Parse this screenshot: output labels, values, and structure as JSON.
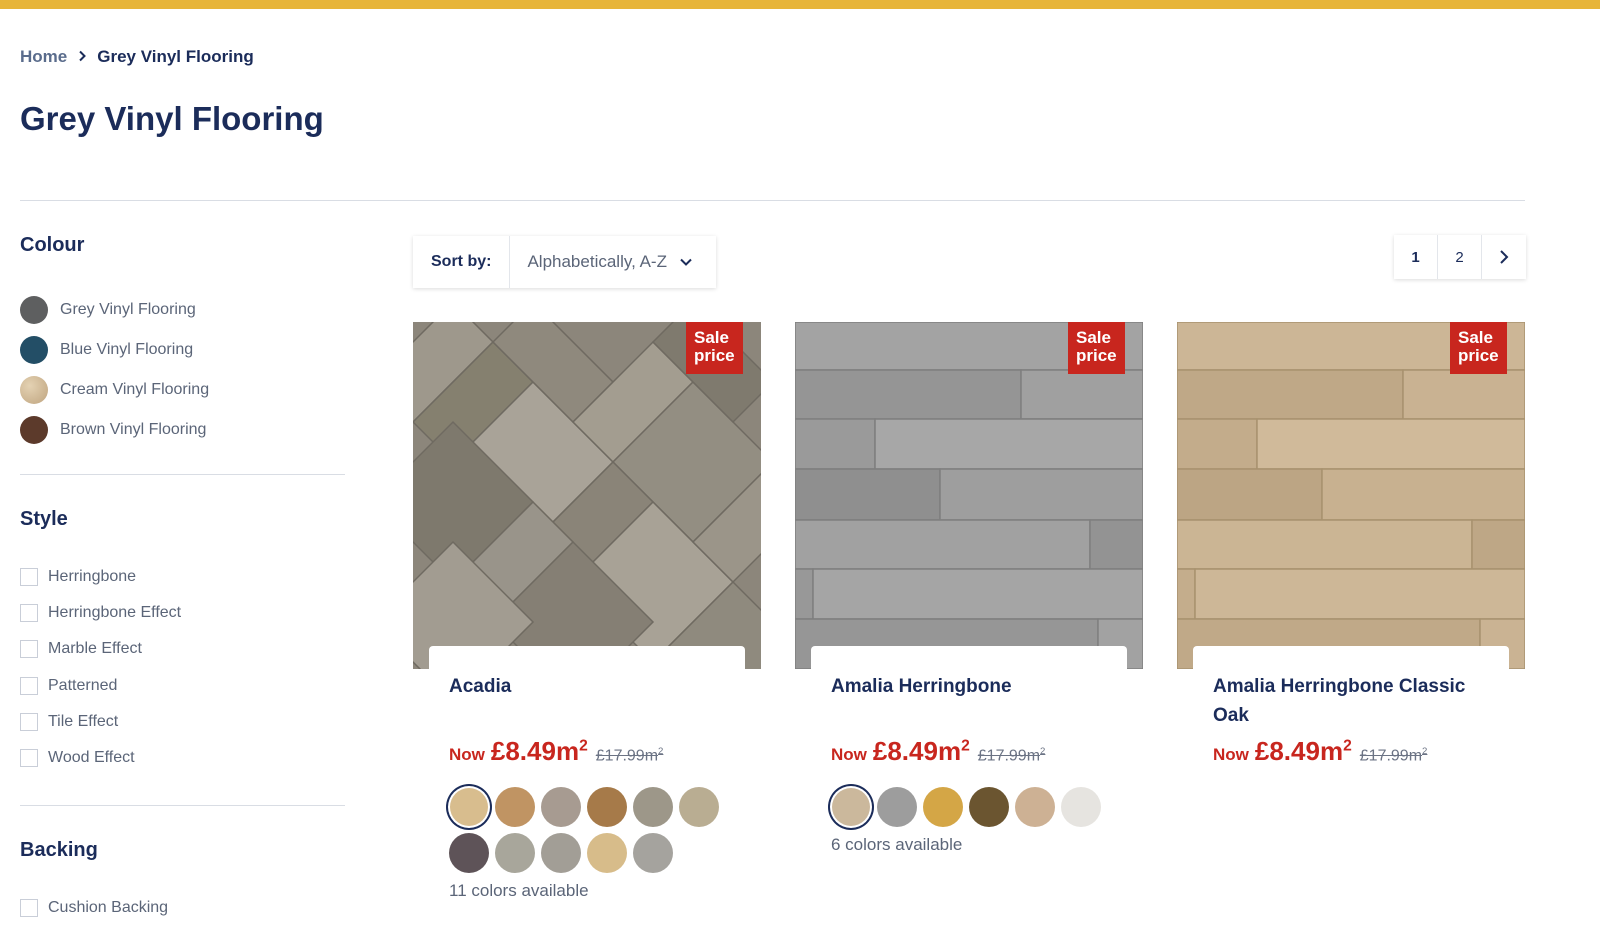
{
  "breadcrumb": {
    "home": "Home",
    "separator": "›",
    "current": "Grey Vinyl Flooring"
  },
  "page_title": "Grey Vinyl Flooring",
  "colors": {
    "accent_bar": "#e7b53a",
    "navy": "#1b2c5a",
    "sale_red": "#c8261e"
  },
  "sidebar": {
    "colour": {
      "heading": "Colour",
      "items": [
        {
          "label": "Grey Vinyl Flooring",
          "swatch": "#5e5f60"
        },
        {
          "label": "Blue Vinyl Flooring",
          "swatch": "#234e66"
        },
        {
          "label": "Cream Vinyl Flooring",
          "swatch": "#cdb593"
        },
        {
          "label": "Brown Vinyl Flooring",
          "swatch": "#5c3a2b"
        }
      ]
    },
    "style": {
      "heading": "Style",
      "items": [
        "Herringbone",
        "Herringbone Effect",
        "Marble Effect",
        "Patterned",
        "Tile Effect",
        "Wood Effect"
      ]
    },
    "backing": {
      "heading": "Backing",
      "items": [
        "Cushion Backing"
      ]
    }
  },
  "toolbar": {
    "sort_label": "Sort by:",
    "sort_value": "Alphabetically, A-Z",
    "pages": [
      "1",
      "2"
    ],
    "active_page": "1"
  },
  "products": [
    {
      "name": "Acadia",
      "badge": "Sale price",
      "now_label": "Now",
      "price": "£8.49m",
      "price_unit_sup": "2",
      "was_price": "£17.99m",
      "was_unit_sup": "2",
      "swatches": [
        "#d8bd8e",
        "#c09463",
        "#a79b91",
        "#a67a49",
        "#9d9789",
        "#b9ad92",
        "#5e5358",
        "#a8a69b",
        "#a29e96",
        "#d7bc8a",
        "#a5a39e"
      ],
      "colors_available": "11 colors available"
    },
    {
      "name": "Amalia Herringbone",
      "badge": "Sale price",
      "now_label": "Now",
      "price": "£8.49m",
      "price_unit_sup": "2",
      "was_price": "£17.99m",
      "was_unit_sup": "2",
      "swatches": [
        "#cbb89c",
        "#9d9d9d",
        "#d4a646",
        "#6b5530",
        "#cdb194",
        "#e6e4e0"
      ],
      "colors_available": "6 colors available"
    },
    {
      "name": "Amalia Herringbone Classic Oak",
      "badge": "Sale price",
      "now_label": "Now",
      "price": "£8.49m",
      "price_unit_sup": "2",
      "was_price": "£17.99m",
      "was_unit_sup": "2",
      "swatches": [],
      "colors_available": ""
    }
  ]
}
